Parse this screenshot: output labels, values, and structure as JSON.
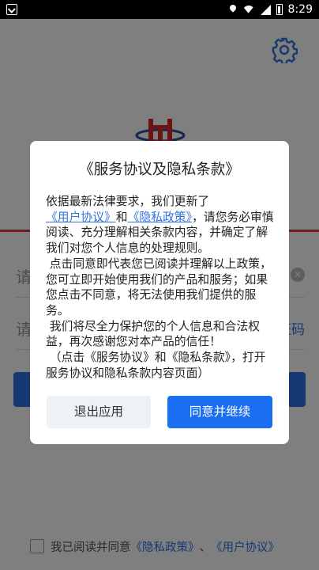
{
  "status_bar": {
    "time": "8:29"
  },
  "app": {
    "phone_placeholder": "请",
    "code_placeholder": "请",
    "get_code_label": "证码",
    "agree_text": "我已阅读并同意",
    "privacy_link": "《隐私政策》",
    "separator": "、",
    "user_agreement_link": "《用户协议》"
  },
  "dialog": {
    "title": "《服务协议及隐私条款》",
    "para1_a": "依据最新法律要求，我们更新了",
    "link_user_agreement": "《用户协议》",
    "para1_and": "和",
    "link_privacy": "《隐私政策》",
    "para1_b": "，请您务必审慎阅读、充分理解相关条款内容，并确定了解我们对您个人信息的处理规则。",
    "para2": "点击同意即代表您已阅读并理解以上政策，您可立即开始使用我们的产品和服务；如果您点击不同意，将无法使用我们提供的服务。",
    "para3": "我们将尽全力保护您的个人信息和合法权益，再次感谢您对本产品的信任！",
    "para4": "（点击《服务协议》和《隐私条款》，打开服务协议和隐私条款内容页面）",
    "exit_label": "退出应用",
    "agree_label": "同意并继续"
  },
  "colors": {
    "accent": "#1a6ef0",
    "brand_red": "#e23a3a"
  }
}
